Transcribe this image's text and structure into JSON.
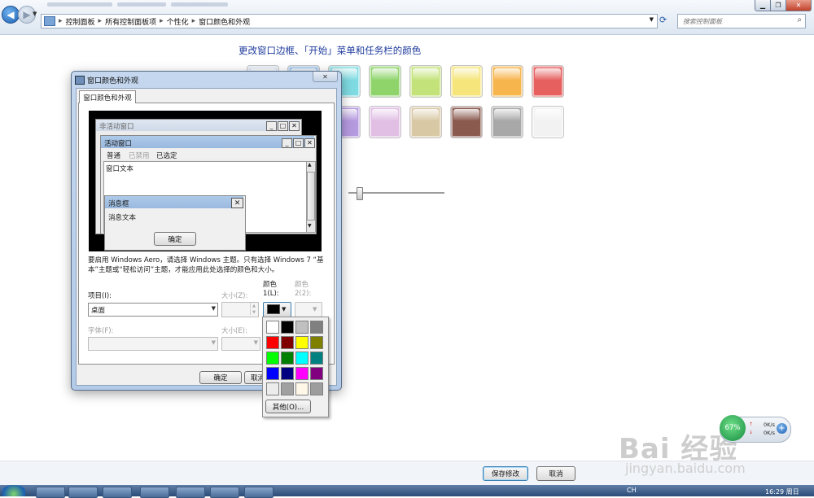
{
  "explorer": {
    "breadcrumbs": [
      "控制面板",
      "所有控制面板项",
      "个性化",
      "窗口颜色和外观"
    ],
    "search_placeholder": "搜索控制面板"
  },
  "page": {
    "heading": "更改窗口边框、「开始」菜单和任务栏的颜色",
    "swatch_colors_row1": [
      "#dfe9f5",
      "#9cc3ec",
      "#7fdbe2",
      "#8fd46b",
      "#c3e37a",
      "#f5e57a",
      "#f7b54e",
      "#e66060"
    ],
    "swatch_colors_row2": [
      "#b69ae0",
      "#e1bfe4",
      "#d9c8a4",
      "#8a5a4f",
      "#a8a8a8",
      "#f2f2f2"
    ],
    "save_label": "保存修改",
    "cancel_label": "取消"
  },
  "dialog": {
    "title": "窗口颜色和外观",
    "tab_label": "窗口颜色和外观",
    "preview": {
      "inactive_title": "非活动窗口",
      "active_title": "活动窗口",
      "menu_normal": "普通",
      "menu_disabled": "已禁用",
      "menu_selected": "已选定",
      "window_text": "窗口文本",
      "msgbox_title": "消息框",
      "msgbox_text": "消息文本",
      "msgbox_ok": "确定"
    },
    "info_text": "要启用 Windows Aero，请选择 Windows 主题。只有选择 Windows 7 “基本”主题或“轻松访问”主题，才能应用此处选择的颜色和大小。",
    "item_label": "项目(I):",
    "item_value": "桌面",
    "size_label": "大小(Z):",
    "color1_label": "颜色 1(L):",
    "color2_label": "颜色 2(2):",
    "color1_value": "#000000",
    "font_label": "字体(F):",
    "font_size_label": "大小(E):",
    "ok_label": "确定",
    "cancel_label": "取消",
    "palette": {
      "colors": [
        "#ffffff",
        "#000000",
        "#c0c0c0",
        "#808080",
        "#ff0000",
        "#800000",
        "#ffff00",
        "#808000",
        "#00ff00",
        "#008000",
        "#00ffff",
        "#008080",
        "#0000ff",
        "#000080",
        "#ff00ff",
        "#800080",
        "#ececec",
        "#a0a0a0",
        "#fff8e8",
        "#9d9d9d"
      ],
      "other_label": "其他(O)..."
    }
  },
  "widget": {
    "percent": "67%",
    "up": "0K/s",
    "down": "0K/s"
  },
  "watermark": {
    "brand": "Bai 经验",
    "url": "jingyan.baidu.com"
  },
  "taskbar": {
    "lang": "CH",
    "time": "16:29 周日"
  }
}
